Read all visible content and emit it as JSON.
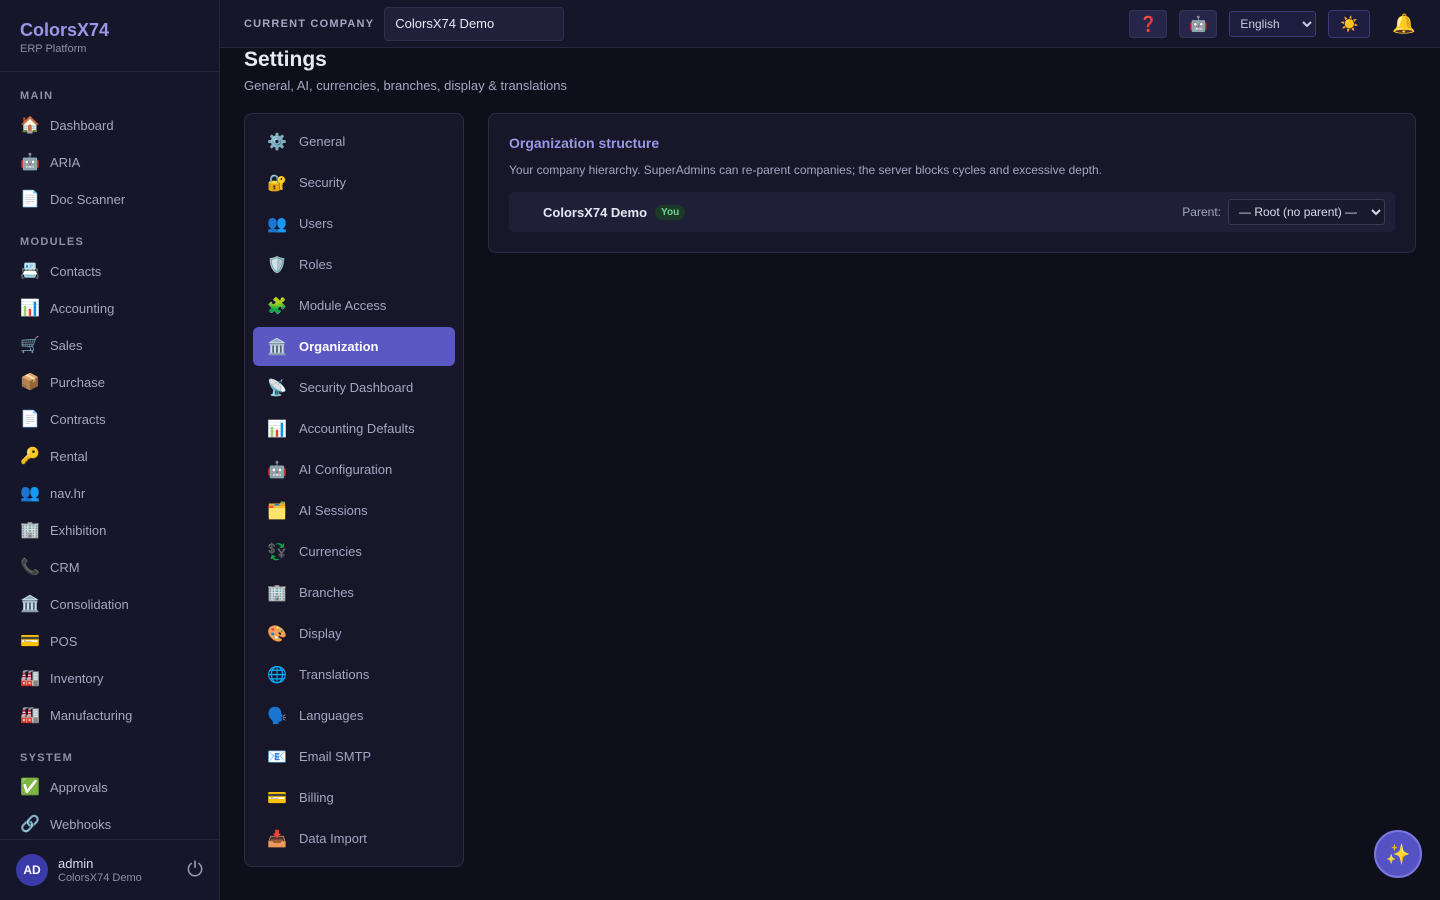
{
  "brand": {
    "title": "ColorsX74",
    "subtitle": "ERP Platform"
  },
  "sidebar": {
    "sections": [
      {
        "title": "MAIN",
        "items": [
          {
            "icon": "🏠",
            "label": "Dashboard"
          },
          {
            "icon": "🤖",
            "label": "ARIA"
          },
          {
            "icon": "📄",
            "label": "Doc Scanner"
          }
        ]
      },
      {
        "title": "MODULES",
        "items": [
          {
            "icon": "📇",
            "label": "Contacts"
          },
          {
            "icon": "📊",
            "label": "Accounting"
          },
          {
            "icon": "🛒",
            "label": "Sales"
          },
          {
            "icon": "📦",
            "label": "Purchase"
          },
          {
            "icon": "📄",
            "label": "Contracts"
          },
          {
            "icon": "🔑",
            "label": "Rental"
          },
          {
            "icon": "👥",
            "label": "nav.hr"
          },
          {
            "icon": "🏢",
            "label": "Exhibition"
          },
          {
            "icon": "📞",
            "label": "CRM"
          },
          {
            "icon": "🏛️",
            "label": "Consolidation"
          },
          {
            "icon": "💳",
            "label": "POS"
          },
          {
            "icon": "🏭",
            "label": "Inventory"
          },
          {
            "icon": "🏭",
            "label": "Manufacturing"
          }
        ]
      },
      {
        "title": "SYSTEM",
        "items": [
          {
            "icon": "✅",
            "label": "Approvals"
          },
          {
            "icon": "🔗",
            "label": "Webhooks"
          }
        ]
      }
    ],
    "user": {
      "initials": "AD",
      "name": "admin",
      "company": "ColorsX74 Demo",
      "logout_icon": "⏻"
    }
  },
  "topbar": {
    "company_label": "CURRENT COMPANY",
    "company_value": "ColorsX74 Demo",
    "help_icon": "❓",
    "ai_icon": "🤖",
    "language": "English",
    "theme_icon": "☀️",
    "bell_icon": "🔔"
  },
  "page": {
    "title": "Settings",
    "subtitle": "General, AI, currencies, branches, display & translations"
  },
  "settings_nav": [
    {
      "icon": "⚙️",
      "label": "General",
      "active": false
    },
    {
      "icon": "🔐",
      "label": "Security",
      "active": false
    },
    {
      "icon": "👥",
      "label": "Users",
      "active": false
    },
    {
      "icon": "🛡️",
      "label": "Roles",
      "active": false
    },
    {
      "icon": "🧩",
      "label": "Module Access",
      "active": false
    },
    {
      "icon": "🏛️",
      "label": "Organization",
      "active": true
    },
    {
      "icon": "📡",
      "label": "Security Dashboard",
      "active": false
    },
    {
      "icon": "📊",
      "label": "Accounting Defaults",
      "active": false
    },
    {
      "icon": "🤖",
      "label": "AI Configuration",
      "active": false
    },
    {
      "icon": "🗂️",
      "label": "AI Sessions",
      "active": false
    },
    {
      "icon": "💱",
      "label": "Currencies",
      "active": false
    },
    {
      "icon": "🏢",
      "label": "Branches",
      "active": false
    },
    {
      "icon": "🎨",
      "label": "Display",
      "active": false
    },
    {
      "icon": "🌐",
      "label": "Translations",
      "active": false
    },
    {
      "icon": "🗣️",
      "label": "Languages",
      "active": false
    },
    {
      "icon": "📧",
      "label": "Email SMTP",
      "active": false
    },
    {
      "icon": "💳",
      "label": "Billing",
      "active": false
    },
    {
      "icon": "📥",
      "label": "Data Import",
      "active": false
    }
  ],
  "org_panel": {
    "title": "Organization structure",
    "description": "Your company hierarchy. SuperAdmins can re-parent companies; the server blocks cycles and excessive depth.",
    "company_name": "ColorsX74 Demo",
    "badge": "You",
    "parent_label": "Parent:",
    "parent_value": "— Root (no parent) —"
  },
  "fab_icon": "✨"
}
